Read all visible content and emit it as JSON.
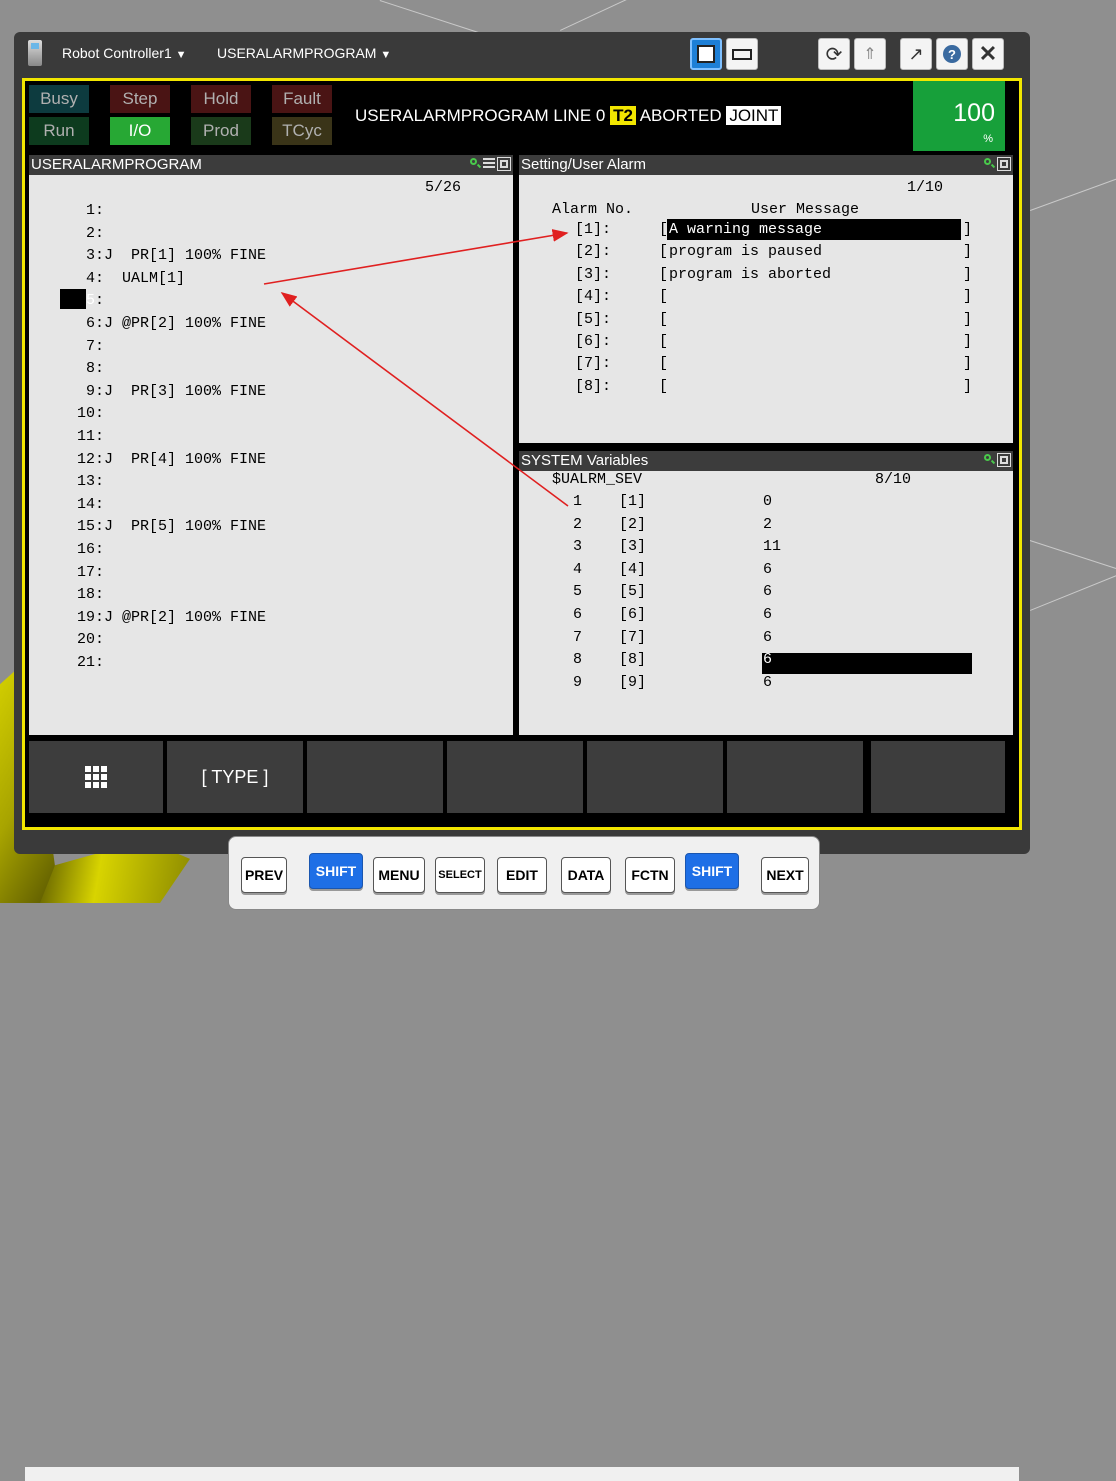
{
  "titlebar": {
    "controller_label": "Robot Controller1",
    "program_label": "USERALARMPROGRAM",
    "dropdown_glyph": "▼"
  },
  "status": {
    "busy": "Busy",
    "step": "Step",
    "hold": "Hold",
    "fault": "Fault",
    "run": "Run",
    "io": "I/O",
    "prod": "Prod",
    "tcyc": "TCyc",
    "program_line": "USERALARMPROGRAM LINE 0",
    "mode": "T2",
    "state": "ABORTED",
    "coord": "JOINT",
    "override_value": "100",
    "override_unit": "%",
    "colors": {
      "busy_bg": "#0d3b3f",
      "step_bg": "#4a1414",
      "run_bg": "#0d3b1e",
      "io_bg": "#27a834",
      "prod_bg": "#1a3a1a",
      "tcyc_bg": "#3a3418"
    }
  },
  "program_pane": {
    "title": "USERALARMPROGRAM",
    "position": "5/26",
    "lines": [
      "   1:",
      "   2:",
      "   3:J  PR[1] 100% FINE",
      "   4:  UALM[1]",
      "   5:",
      "   6:J @PR[2] 100% FINE",
      "   7:",
      "   8:",
      "   9:J  PR[3] 100% FINE",
      "  10:",
      "  11:",
      "  12:J  PR[4] 100% FINE",
      "  13:",
      "  14:",
      "  15:J  PR[5] 100% FINE",
      "  16:",
      "  17:",
      "  18:",
      "  19:J @PR[2] 100% FINE",
      "  20:",
      "  21:"
    ],
    "cursor_line": "5"
  },
  "alarm_pane": {
    "title": "Setting/User Alarm",
    "position": "1/10",
    "col_alarm": "Alarm No.",
    "col_message": "User Message",
    "rows": [
      {
        "no": "[1]:",
        "message": "A warning message"
      },
      {
        "no": "[2]:",
        "message": "program is paused"
      },
      {
        "no": "[3]:",
        "message": "program is aborted"
      },
      {
        "no": "[4]:",
        "message": ""
      },
      {
        "no": "[5]:",
        "message": ""
      },
      {
        "no": "[6]:",
        "message": ""
      },
      {
        "no": "[7]:",
        "message": ""
      },
      {
        "no": "[8]:",
        "message": ""
      }
    ],
    "open_bracket": "[",
    "close_bracket": "]"
  },
  "sysvar_pane": {
    "title": "SYSTEM Variables",
    "variable": "$UALRM_SEV",
    "position": "8/10",
    "rows": [
      {
        "idx": "1",
        "key": "[1]",
        "value": "0"
      },
      {
        "idx": "2",
        "key": "[2]",
        "value": "2"
      },
      {
        "idx": "3",
        "key": "[3]",
        "value": "11"
      },
      {
        "idx": "4",
        "key": "[4]",
        "value": "6"
      },
      {
        "idx": "5",
        "key": "[5]",
        "value": "6"
      },
      {
        "idx": "6",
        "key": "[6]",
        "value": "6"
      },
      {
        "idx": "7",
        "key": "[7]",
        "value": "6"
      },
      {
        "idx": "8",
        "key": "[8]",
        "value": "6"
      },
      {
        "idx": "9",
        "key": "[9]",
        "value": "6"
      }
    ]
  },
  "function_keys": {
    "f1_icon": "grid-icon",
    "f2_label": "[ TYPE ]"
  },
  "hard_keys": {
    "prev": "PREV",
    "shift_left": "SHIFT",
    "menu": "MENU",
    "select": "SELECT",
    "edit": "EDIT",
    "data": "DATA",
    "fctn": "FCTN",
    "shift_right": "SHIFT",
    "next": "NEXT"
  },
  "annotation_color": "#e02020"
}
